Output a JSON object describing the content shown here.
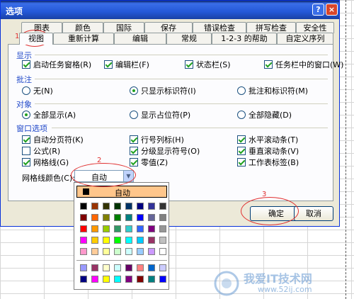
{
  "window": {
    "title": "选项",
    "help_glyph": "?",
    "close_glyph": "×"
  },
  "tabs_row1": [
    "图表",
    "颜色",
    "国际",
    "保存",
    "错误检查",
    "拼写检查",
    "安全性"
  ],
  "tabs_row2": [
    "视图",
    "重新计算",
    "编辑",
    "常规",
    "1-2-3 的帮助",
    "自定义序列"
  ],
  "sections": {
    "display": {
      "title": "显示",
      "items": [
        {
          "label": "启动任务窗格(R)",
          "checked": true
        },
        {
          "label": "编辑栏(F)",
          "checked": true
        },
        {
          "label": "状态栏(S)",
          "checked": true
        },
        {
          "label": "任务栏中的窗口(W)",
          "checked": true
        }
      ]
    },
    "comments": {
      "title": "批注",
      "items": [
        {
          "label": "无(N)",
          "selected": false
        },
        {
          "label": "只显示标识符(I)",
          "selected": true
        },
        {
          "label": "批注和标识符(M)",
          "selected": false
        }
      ]
    },
    "objects": {
      "title": "对象",
      "items": [
        {
          "label": "全部显示(A)",
          "selected": true
        },
        {
          "label": "显示占位符(P)",
          "selected": false
        },
        {
          "label": "全部隐藏(D)",
          "selected": false
        }
      ]
    },
    "window_options": {
      "title": "窗口选项",
      "items": [
        {
          "label": "自动分页符(K)",
          "checked": true
        },
        {
          "label": "行号列标(H)",
          "checked": true
        },
        {
          "label": "水平滚动条(T)",
          "checked": true
        },
        {
          "label": "公式(R)",
          "checked": false
        },
        {
          "label": "分级显示符号(O)",
          "checked": true
        },
        {
          "label": "垂直滚动条(V)",
          "checked": true
        },
        {
          "label": "网格线(G)",
          "checked": true
        },
        {
          "label": "零值(Z)",
          "checked": true
        },
        {
          "label": "工作表标签(B)",
          "checked": true
        }
      ],
      "gridline_color_label": "网格线颜色(C):",
      "gridline_color_value": "自动"
    }
  },
  "buttons": {
    "ok": "确定",
    "cancel": "取消"
  },
  "color_picker": {
    "auto_label": "自动",
    "palette_main": [
      [
        "#000000",
        "#993300",
        "#333300",
        "#003300",
        "#003366",
        "#000080",
        "#333399",
        "#333333"
      ],
      [
        "#800000",
        "#FF6600",
        "#808000",
        "#008000",
        "#008080",
        "#0000FF",
        "#666699",
        "#808080"
      ],
      [
        "#FF0000",
        "#FF9900",
        "#99CC00",
        "#339966",
        "#33CCCC",
        "#3366FF",
        "#800080",
        "#969696"
      ],
      [
        "#FF00FF",
        "#FFCC00",
        "#FFFF00",
        "#00FF00",
        "#00FFFF",
        "#00CCFF",
        "#993366",
        "#C0C0C0"
      ],
      [
        "#FF99CC",
        "#FFCC99",
        "#FFFF99",
        "#CCFFCC",
        "#CCFFFF",
        "#99CCFF",
        "#CC99FF",
        "#FFFFFF"
      ]
    ],
    "palette_extra": [
      [
        "#9999FF",
        "#993366",
        "#FFFFCC",
        "#CCFFFF",
        "#660066",
        "#FF8080",
        "#0066CC",
        "#CCCCFF"
      ],
      [
        "#000080",
        "#FF00FF",
        "#FFFF00",
        "#00FFFF",
        "#800080",
        "#800000",
        "#008080",
        "#0000FF"
      ]
    ]
  },
  "annotations": [
    "1",
    "2",
    "3"
  ],
  "watermark": {
    "text": "我爱IT技术网",
    "url": "www.52ij.com"
  }
}
